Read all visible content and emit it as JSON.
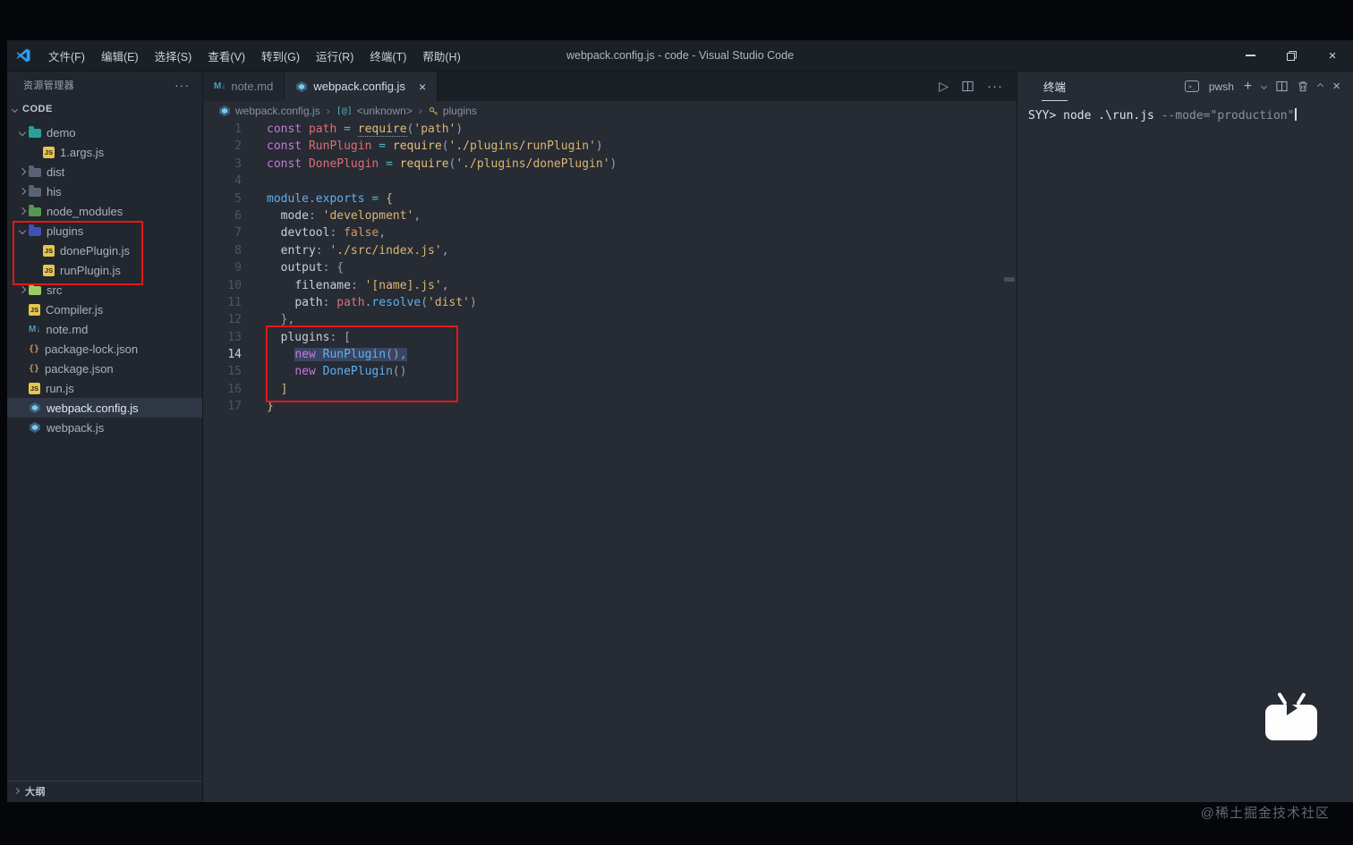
{
  "titlebar": {
    "title": "webpack.config.js - code - Visual Studio Code",
    "menus": [
      "文件(F)",
      "编辑(E)",
      "选择(S)",
      "查看(V)",
      "转到(G)",
      "运行(R)",
      "终端(T)",
      "帮助(H)"
    ]
  },
  "icons": {
    "more": "···",
    "close": "×",
    "plus": "+",
    "run": "▷",
    "minimize": "─",
    "pwsh_badge": ">_"
  },
  "sidebar": {
    "title": "资源管理器",
    "section": "CODE",
    "outline": "大纲",
    "tree": [
      {
        "label": "demo",
        "icon": "folder",
        "color": "#2aa198",
        "chev": "down",
        "depth": 0
      },
      {
        "label": "1.args.js",
        "icon": "js",
        "depth": 1
      },
      {
        "label": "dist",
        "icon": "folder",
        "color": "#5a6374",
        "chev": "right",
        "depth": 0
      },
      {
        "label": "his",
        "icon": "folder",
        "color": "#5a6374",
        "chev": "right",
        "depth": 0
      },
      {
        "label": "node_modules",
        "icon": "folder",
        "color": "#55984f",
        "chev": "right",
        "depth": 0
      },
      {
        "label": "plugins",
        "icon": "folder",
        "color": "#3f51b5",
        "chev": "down",
        "depth": 0
      },
      {
        "label": "donePlugin.js",
        "icon": "js",
        "depth": 1
      },
      {
        "label": "runPlugin.js",
        "icon": "js",
        "depth": 1
      },
      {
        "label": "src",
        "icon": "folder",
        "color": "#9ccc65",
        "chev": "right",
        "depth": 0
      },
      {
        "label": "Compiler.js",
        "icon": "js",
        "depth": 0
      },
      {
        "label": "note.md",
        "icon": "md",
        "depth": 0
      },
      {
        "label": "package-lock.json",
        "icon": "json",
        "depth": 0
      },
      {
        "label": "package.json",
        "icon": "json",
        "depth": 0
      },
      {
        "label": "run.js",
        "icon": "js",
        "depth": 0
      },
      {
        "label": "webpack.config.js",
        "icon": "webpack",
        "depth": 0,
        "selected": true
      },
      {
        "label": "webpack.js",
        "icon": "webpack",
        "depth": 0
      }
    ]
  },
  "editor": {
    "tabs": [
      {
        "label": "note.md",
        "icon": "md"
      },
      {
        "label": "webpack.config.js",
        "icon": "webpack",
        "active": true
      }
    ],
    "breadcrumbs": [
      {
        "label": "webpack.config.js",
        "icon": "webpack"
      },
      {
        "label": "<unknown>",
        "icon": "symbol"
      },
      {
        "label": "plugins",
        "icon": "key"
      }
    ],
    "lines": [
      {
        "n": 1,
        "t": [
          [
            "const",
            "kw"
          ],
          [
            " ",
            "pl"
          ],
          [
            "path",
            "vr"
          ],
          [
            " ",
            "pl"
          ],
          [
            "=",
            "op"
          ],
          [
            " ",
            "pl"
          ],
          [
            "require",
            "fn dots"
          ],
          [
            "(",
            "pl"
          ],
          [
            "'path'",
            "st"
          ],
          [
            ")",
            "pl"
          ]
        ]
      },
      {
        "n": 2,
        "t": [
          [
            "const",
            "kw"
          ],
          [
            " ",
            "pl"
          ],
          [
            "RunPlugin",
            "vr"
          ],
          [
            " ",
            "pl"
          ],
          [
            "=",
            "op"
          ],
          [
            " ",
            "pl"
          ],
          [
            "require",
            "fn"
          ],
          [
            "(",
            "pl"
          ],
          [
            "'./plugins/runPlugin'",
            "st"
          ],
          [
            ")",
            "pl"
          ]
        ]
      },
      {
        "n": 3,
        "t": [
          [
            "const",
            "kw"
          ],
          [
            " ",
            "pl"
          ],
          [
            "DonePlugin",
            "vr"
          ],
          [
            " ",
            "pl"
          ],
          [
            "=",
            "op"
          ],
          [
            " ",
            "pl"
          ],
          [
            "require",
            "fn"
          ],
          [
            "(",
            "pl"
          ],
          [
            "'./plugins/donePlugin'",
            "st"
          ],
          [
            ")",
            "pl"
          ]
        ]
      },
      {
        "n": 4,
        "t": []
      },
      {
        "n": 5,
        "t": [
          [
            "module",
            "bl"
          ],
          [
            ".",
            "pl"
          ],
          [
            "exports",
            "bl"
          ],
          [
            " ",
            "pl"
          ],
          [
            "=",
            "op"
          ],
          [
            " ",
            "pl"
          ],
          [
            "{",
            "br"
          ]
        ]
      },
      {
        "n": 6,
        "t": [
          [
            "  ",
            "pl"
          ],
          [
            "mode",
            "pr"
          ],
          [
            ": ",
            "pl"
          ],
          [
            "'development'",
            "st"
          ],
          [
            ",",
            "pl"
          ]
        ]
      },
      {
        "n": 7,
        "t": [
          [
            "  ",
            "pl"
          ],
          [
            "devtool",
            "pr"
          ],
          [
            ": ",
            "pl"
          ],
          [
            "false",
            "num"
          ],
          [
            ",",
            "pl"
          ]
        ]
      },
      {
        "n": 8,
        "t": [
          [
            "  ",
            "pl"
          ],
          [
            "entry",
            "pr"
          ],
          [
            ": ",
            "pl"
          ],
          [
            "'./src/index.js'",
            "st"
          ],
          [
            ",",
            "pl"
          ]
        ]
      },
      {
        "n": 9,
        "t": [
          [
            "  ",
            "pl"
          ],
          [
            "output",
            "pr"
          ],
          [
            ": ",
            "pl"
          ],
          [
            "{",
            "pl"
          ]
        ]
      },
      {
        "n": 10,
        "t": [
          [
            "    ",
            "pl"
          ],
          [
            "filename",
            "pr"
          ],
          [
            ": ",
            "pl"
          ],
          [
            "'[name].js'",
            "st"
          ],
          [
            ",",
            "pl"
          ]
        ]
      },
      {
        "n": 11,
        "t": [
          [
            "    ",
            "pl"
          ],
          [
            "path",
            "pr"
          ],
          [
            ": ",
            "pl"
          ],
          [
            "path",
            "vr"
          ],
          [
            ".",
            "pl"
          ],
          [
            "resolve",
            "bl"
          ],
          [
            "(",
            "pl"
          ],
          [
            "'dist'",
            "st"
          ],
          [
            ")",
            "pl"
          ]
        ]
      },
      {
        "n": 12,
        "t": [
          [
            "  },",
            "pl"
          ]
        ]
      },
      {
        "n": 13,
        "t": [
          [
            "  ",
            "pl"
          ],
          [
            "plugins",
            "pr"
          ],
          [
            ": ",
            "pl"
          ],
          [
            "[",
            "pl"
          ]
        ]
      },
      {
        "n": 14,
        "active": true,
        "t": [
          [
            "    ",
            "pl"
          ],
          [
            "new",
            "kw hl"
          ],
          [
            " ",
            "pl hl"
          ],
          [
            "RunPlugin",
            "bl hl"
          ],
          [
            "(),",
            "pl hl"
          ]
        ]
      },
      {
        "n": 15,
        "t": [
          [
            "    ",
            "pl"
          ],
          [
            "new",
            "kw"
          ],
          [
            " ",
            "pl"
          ],
          [
            "DonePlugin",
            "bl"
          ],
          [
            "()",
            "pl"
          ]
        ]
      },
      {
        "n": 16,
        "t": [
          [
            "  ",
            "pl"
          ],
          [
            "]",
            "br"
          ]
        ]
      },
      {
        "n": 17,
        "t": [
          [
            "}",
            "br"
          ]
        ]
      }
    ]
  },
  "terminal": {
    "title": "终端",
    "shell": "pwsh",
    "line": {
      "prompt": "SYY>",
      "command": " node .\\run.js ",
      "args": "--mode=\"production\""
    }
  },
  "annotations": {
    "watermark": "@稀土掘金技术社区"
  },
  "colors": {
    "annotation_red": "#e51717",
    "accent_blue": "#61afef",
    "editor_bg": "#262b34",
    "sidebar_bg": "#22262e",
    "titlebar_bg": "#1b1f26",
    "selection_highlight": "rgba(92,121,190,0.35)"
  }
}
